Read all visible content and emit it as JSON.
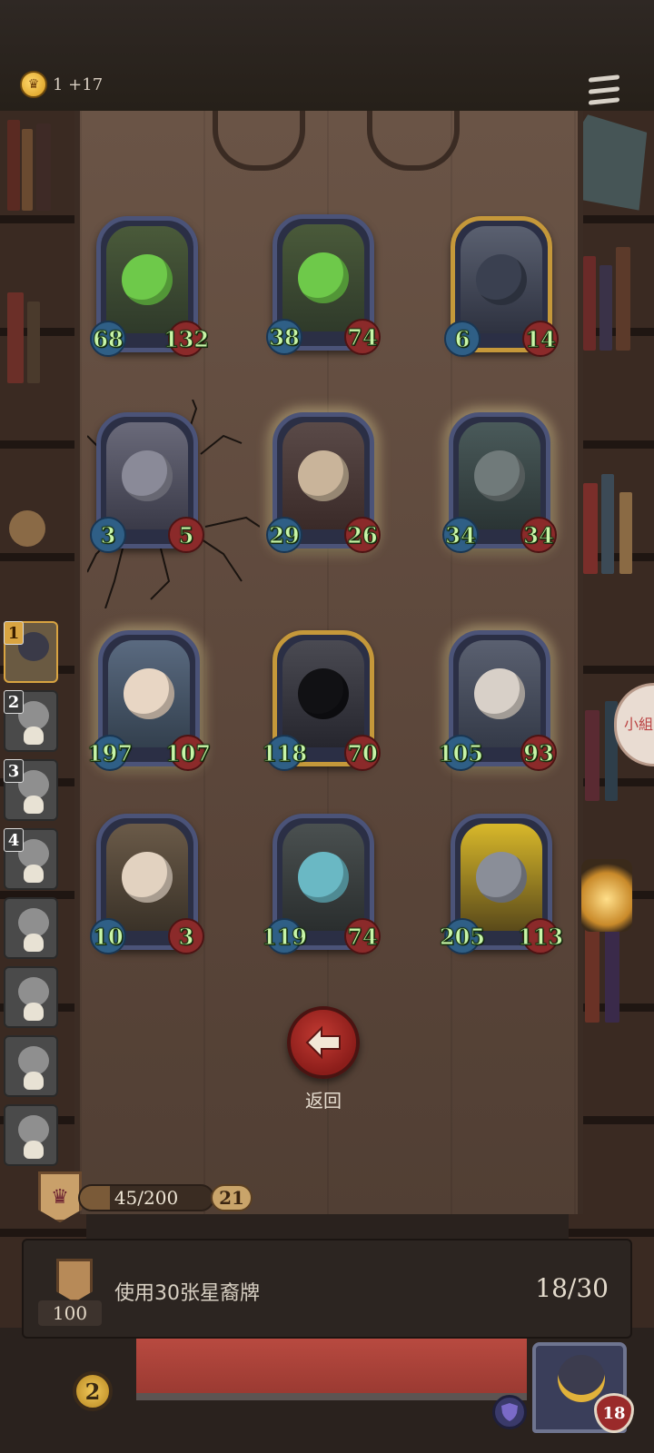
{
  "top": {
    "coin_icon": "crown-coin-icon",
    "coin_text": "1 +17",
    "menu_icon": "hamburger-menu-icon"
  },
  "cards": [
    {
      "atk": "68",
      "hp": "132",
      "frame": "silver",
      "glow": false,
      "art": "green-dragon-slime"
    },
    {
      "atk": "38",
      "hp": "74",
      "frame": "silver",
      "glow": false,
      "art": "green-dragon-slime"
    },
    {
      "atk": "6",
      "hp": "14",
      "frame": "gold",
      "glow": false,
      "art": "hooded-rogue"
    },
    {
      "atk": "3",
      "hp": "5",
      "frame": "silver",
      "glow": false,
      "art": "grey-dragon"
    },
    {
      "atk": "29",
      "hp": "26",
      "frame": "silver",
      "glow": true,
      "art": "horned-beast"
    },
    {
      "atk": "34",
      "hp": "34",
      "frame": "silver",
      "glow": true,
      "art": "armored-knight"
    },
    {
      "atk": "197",
      "hp": "107",
      "frame": "silver",
      "glow": true,
      "art": "young-wizard"
    },
    {
      "atk": "118",
      "hp": "70",
      "frame": "gold",
      "glow": false,
      "art": "shadow-reaper"
    },
    {
      "atk": "105",
      "hp": "93",
      "frame": "silver",
      "glow": true,
      "art": "old-wizard"
    },
    {
      "atk": "10",
      "hp": "3",
      "frame": "silver",
      "glow": false,
      "art": "old-woman"
    },
    {
      "atk": "119",
      "hp": "74",
      "frame": "silver",
      "glow": false,
      "art": "skeleton-beast"
    },
    {
      "atk": "205",
      "hp": "113",
      "frame": "silver",
      "glow": false,
      "art": "lightning-robot"
    }
  ],
  "roster": [
    {
      "num": "1",
      "active": true
    },
    {
      "num": "2",
      "active": false
    },
    {
      "num": "3",
      "active": false
    },
    {
      "num": "4",
      "active": false
    },
    {
      "num": "",
      "active": false
    },
    {
      "num": "",
      "active": false
    },
    {
      "num": "",
      "active": false
    },
    {
      "num": "",
      "active": false
    }
  ],
  "back": {
    "label": "返回",
    "icon": "arrow-left-icon"
  },
  "progress": {
    "xp_text": "45/200",
    "xp_fraction": 0.225,
    "level": "21",
    "badge_icon": "crown-badge-icon"
  },
  "quest": {
    "text": "使用30张星裔牌",
    "progress": "18/30",
    "reward": "100"
  },
  "bottom": {
    "gold_count": "2",
    "hero_health": "18",
    "shield_icon": "shield-icon",
    "side_tab": "小組"
  },
  "colors": {
    "atk": "#2f5f86",
    "hp": "#8b2a2a",
    "stat_text": "#c8f5a8",
    "gold_frame": "#c5983a",
    "silver_frame": "#4b5378"
  }
}
